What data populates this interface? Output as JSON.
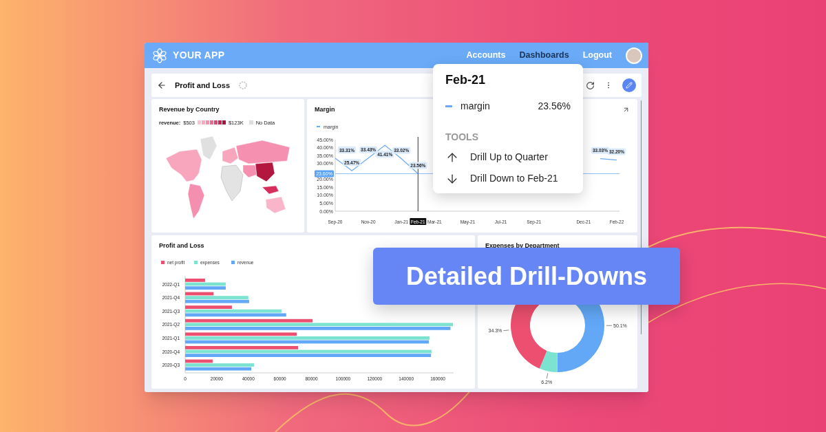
{
  "header": {
    "app_name": "YOUR APP",
    "nav": [
      {
        "label": "Accounts",
        "selected": false
      },
      {
        "label": "Dashboards",
        "selected": true
      },
      {
        "label": "Logout",
        "selected": false
      }
    ]
  },
  "toolbar": {
    "title": "Profit and Loss"
  },
  "map_card": {
    "title": "Revenue by Country",
    "legend": {
      "label": "revenue:",
      "min": "$503",
      "max": "$123K",
      "no_data": "No Data"
    }
  },
  "margin_card": {
    "title": "Margin",
    "axis_label_selected": [
      false,
      false,
      false,
      true,
      false,
      false,
      false,
      false,
      false,
      false
    ],
    "chart_data": {
      "type": "line",
      "legend": "top",
      "categories": [
        "Sep-20",
        null,
        "Nov-20",
        null,
        "Jan-21",
        "Feb-21",
        "Mar-21",
        null,
        "May-21",
        null,
        "Jul-21",
        null,
        "Sep-21",
        null,
        null,
        "Dec-21",
        null,
        "Feb-22"
      ],
      "series": [
        {
          "name": "margin",
          "color": "#6aaaf7",
          "values": [
            33.31,
            25.47,
            33.43,
            41.41,
            33.02,
            23.56,
            null,
            null,
            null,
            null,
            null,
            null,
            null,
            null,
            null,
            null,
            33.03,
            32.2
          ]
        }
      ],
      "value_labels": [
        "33.31%",
        "25.47%",
        "33.43%",
        "41.41%",
        "33.02%",
        "23.56%",
        null,
        null,
        null,
        null,
        null,
        null,
        null,
        null,
        null,
        null,
        "33.03%",
        "32.20%"
      ],
      "ylim": [
        0,
        45
      ],
      "yticks": [
        {
          "value": 0,
          "label": "0.00%"
        },
        {
          "value": 5,
          "label": "5.00%"
        },
        {
          "value": 10,
          "label": "10.00%"
        },
        {
          "value": 15,
          "label": "15.00%"
        },
        {
          "value": 20,
          "label": "20.00%"
        },
        {
          "value": 30,
          "label": "30.00%"
        },
        {
          "value": 35,
          "label": "35.00%"
        },
        {
          "value": 40,
          "label": "40.00%"
        },
        {
          "value": 45,
          "label": "45.00%"
        }
      ],
      "ref_lines": [
        {
          "axis": "y",
          "value": 23.6,
          "label": "23.60%"
        }
      ]
    }
  },
  "pl_card": {
    "title": "Profit and Loss",
    "chart_data": {
      "type": "bar",
      "orientation": "horizontal",
      "legend": "top",
      "categories": [
        "2022-Q1",
        "2021-Q4",
        "2021-Q3",
        "2021-Q2",
        "2021-Q1",
        "2020-Q4",
        "2020-Q3"
      ],
      "series": [
        {
          "name": "net profit",
          "color": "#ec4f6f",
          "values": [
            12600,
            18000,
            29600,
            80700,
            70600,
            71500,
            17400
          ]
        },
        {
          "name": "expenses",
          "color": "#7de3d1",
          "values": [
            25700,
            40000,
            61000,
            169600,
            154800,
            156000,
            43600
          ]
        },
        {
          "name": "revenue",
          "color": "#62a8f7",
          "values": [
            25700,
            40500,
            64000,
            168000,
            154300,
            155700,
            41900
          ]
        }
      ],
      "xlim": [
        0,
        170000
      ],
      "xticks": [
        0,
        20000,
        40000,
        60000,
        80000,
        100000,
        120000,
        140000,
        160000
      ]
    }
  },
  "expenses_card": {
    "title": "Expenses by Department",
    "chart_data": {
      "type": "donut",
      "values": [
        50.1,
        6.2,
        34.3
      ],
      "colors": [
        "#62a8f7",
        "#7de3d1",
        "#ec4f6f"
      ],
      "value_labels": [
        "50.1%",
        "6.2%",
        "34.3%"
      ]
    }
  },
  "tooltip": {
    "title": "Feb-21",
    "series": "margin",
    "value": "23.56%",
    "section": "TOOLS",
    "actions": [
      {
        "kind": "up",
        "label": "Drill Up to Quarter"
      },
      {
        "kind": "down",
        "label": "Drill Down to Feb-21"
      }
    ]
  },
  "banner": {
    "text": "Detailed Drill-Downs"
  }
}
